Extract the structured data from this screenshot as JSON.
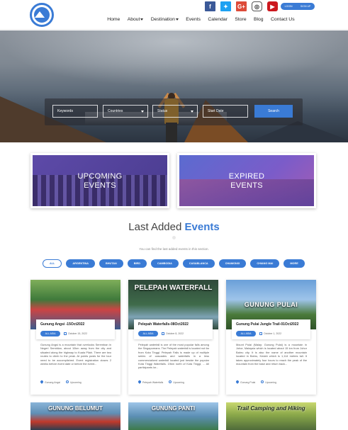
{
  "header": {
    "social": [
      "f",
      "t",
      "G+",
      "ig",
      "yt"
    ],
    "auth": {
      "login": "LOGIN",
      "signup": "SIGN UP"
    },
    "nav": [
      {
        "label": "Home",
        "dropdown": false
      },
      {
        "label": "About",
        "dropdown": true
      },
      {
        "label": "Destination",
        "dropdown": true
      },
      {
        "label": "Events",
        "dropdown": false
      },
      {
        "label": "Calendar",
        "dropdown": false
      },
      {
        "label": "Store",
        "dropdown": false
      },
      {
        "label": "Blog",
        "dropdown": false
      },
      {
        "label": "Contact Us",
        "dropdown": false
      }
    ]
  },
  "search": {
    "keywords": "Keywords",
    "countries": "Countries",
    "status": "Status",
    "start_date": "Start Date",
    "button": "Search"
  },
  "event_types": {
    "upcoming": "UPCOMING\nEVENTS",
    "expired": "EXPIRED\nEVENTS"
  },
  "section": {
    "title_plain": "Last Added",
    "title_highlight": "Events",
    "subtitle": "You can find the last added events in this section."
  },
  "filters": [
    "ALL",
    "ARGENTINA",
    "BHUTAN",
    "BIRD",
    "CAMBODIA",
    "CASABLANCA",
    "CHAMONIX",
    "CHIANG MAI",
    "MORE"
  ],
  "cards": [
    {
      "image_text": "",
      "title": "Gunung Angsi -15Oct2022",
      "badge": "ALL ASIA",
      "date": "October 15, 2022",
      "desc": "Gunung Angsi is a mountain that overlooks Seremban in Negeri Sembilan, about 10km away from the city and situated along the highway to Kuala Pilah. There are two routes to climb to the peak. At points posts for the tour need to be accomplished. Event registration closes 2 weeks before event date or before the event...",
      "location": "Gunung Angsi",
      "status": "Upcoming"
    },
    {
      "image_text": "PELEPAH WATERFALL",
      "title": "Pelepah Waterfalls-08Oct2022",
      "badge": "ALL ASIA",
      "date": "October 8, 2022",
      "desc": "Pelepah waterfall is one of the most popular falls among the Singaporeans. The Pelepah waterfall is located not far from Kota Tinggi. Pelepah Falls is made up of multiple series of cascades and waterfalls in a less commercialized waterfall located just beside the popular Kota Tinggi Waterfalls. 19km north of Kota Tinggi, ... All participants lor...",
      "location": "Pelepah Waterfalls",
      "status": "Upcoming"
    },
    {
      "image_text": "GUNUNG PULAI",
      "title": "Gunung Pulai Jungle Trail-01Oct2022",
      "badge": "ALL ASIA",
      "date": "October 1, 2022",
      "desc": "Mount Pulai (Malay: Gunung Pulai) is a mountain in Johor, Malaysia which is located about 15 km from Johor Bahru city. It is also the name of another mountain located in Bahru, Kedah which is 1,114 metres tall. It takes approximately four hours to reach the peak of the mountain from the base and return back...",
      "location": "Gunung Pulai",
      "status": "Upcoming"
    }
  ],
  "cards_row2": [
    {
      "image_text": "GUNUNG BELUMUT"
    },
    {
      "image_text": "GUNUNG PANTI"
    },
    {
      "image_text": "Trail Camping and Hiking"
    }
  ]
}
